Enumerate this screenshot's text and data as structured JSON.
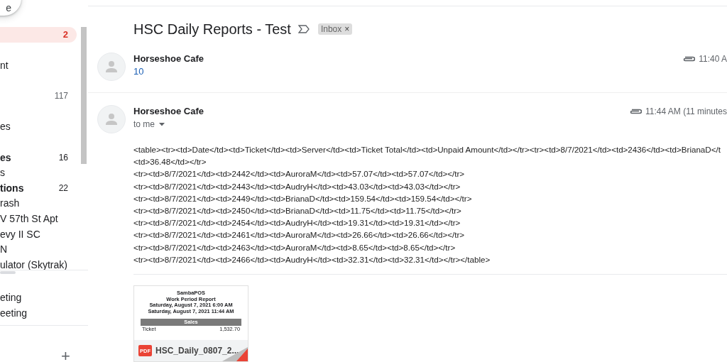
{
  "compose_button": {
    "label": "e"
  },
  "sidebar": {
    "items": [
      {
        "count": "2",
        "selected": true,
        "unread": false
      },
      {
        "label": "nt",
        "selected": false,
        "unread": false
      },
      {
        "count": "117",
        "selected": false,
        "unread": false
      },
      {
        "label": "es",
        "selected": false,
        "unread": false
      },
      {
        "label": "es",
        "count": "16",
        "selected": false,
        "unread": true
      },
      {
        "label": "s",
        "selected": false,
        "unread": false
      },
      {
        "label": "tions",
        "count": "22",
        "selected": false,
        "unread": true
      },
      {
        "label": "rash",
        "selected": false,
        "unread": false
      },
      {
        "label": "V 57th St Apt",
        "selected": false,
        "unread": false
      },
      {
        "label": "evy II SC",
        "selected": false,
        "unread": false
      },
      {
        "label": "N",
        "selected": false,
        "unread": false
      },
      {
        "label": "ulator (Skytrak)",
        "selected": false,
        "unread": false
      }
    ],
    "meetings": [
      "eting",
      "eeting"
    ],
    "add_button": "+"
  },
  "thread": {
    "subject": "HSC Daily Reports - Test",
    "label_chip": "Inbox",
    "chip_close": "×",
    "messages": [
      {
        "sender": "Horseshoe Cafe",
        "snippet": "10",
        "time": "11:40 A",
        "expanded": false
      },
      {
        "sender": "Horseshoe Cafe",
        "recipient": "to me",
        "time": "11:44 AM (11 minutes",
        "expanded": true,
        "body": [
          "<table><tr><td>Date</td><td>Ticket</td><td>Server</td><td>Ticket Total</td><td>Unpaid Amount</td></tr><tr><td>8/7/2021</td><td>2436</td><td>BrianaD</t",
          "<td>36.48</td></tr>",
          "<tr><td>8/7/2021</td><td>2442</td><td>AuroraM</td><td>57.07</td><td>57.07</td></tr>",
          "<tr><td>8/7/2021</td><td>2443</td><td>AudryH</td><td>43.03</td><td>43.03</td></tr>",
          "<tr><td>8/7/2021</td><td>2449</td><td>BrianaD</td><td>159.54</td><td>159.54</td></tr>",
          "<tr><td>8/7/2021</td><td>2450</td><td>BrianaD</td><td>11.75</td><td>11.75</td></tr>",
          "<tr><td>8/7/2021</td><td>2454</td><td>AudryH</td><td>19.31</td><td>19.31</td></tr>",
          "<tr><td>8/7/2021</td><td>2461</td><td>AuroraM</td><td>26.66</td><td>26.66</td></tr>",
          "<tr><td>8/7/2021</td><td>2463</td><td>AuroraM</td><td>8.65</td><td>8.65</td></tr>",
          "<tr><td>8/7/2021</td><td>2466</td><td>AudryH</td><td>32.31</td><td>32.31</td></tr></table>"
        ],
        "attachment": {
          "type_badge": "PDF",
          "file_name": "HSC_Daily_0807_2...",
          "preview": {
            "title_lines": [
              "SambaPOS",
              "Work Period Report",
              "Saturday, August 7, 2021 6:00 AM",
              "Saturday, August 7, 2021 11:44 AM"
            ],
            "section": "Sales",
            "row_label": "Ticket",
            "row_value": "1,532.70"
          }
        }
      }
    ]
  }
}
